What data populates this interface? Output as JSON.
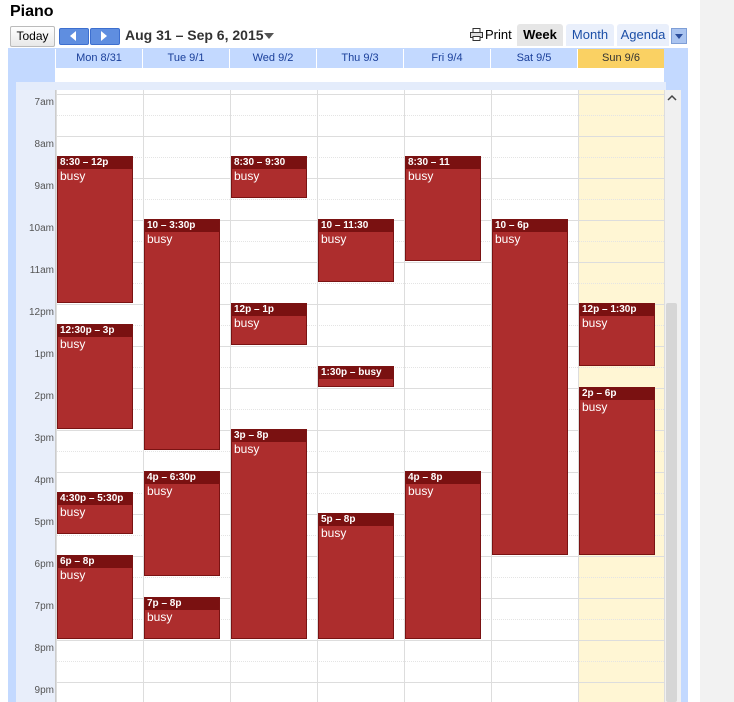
{
  "calendar": {
    "title": "Piano",
    "today_label": "Today",
    "date_range": "Aug 31 – Sep 6, 2015",
    "print_label": "Print",
    "tabs": {
      "week": "Week",
      "month": "Month",
      "agenda": "Agenda"
    }
  },
  "days": [
    "Mon 8/31",
    "Tue 9/1",
    "Wed 9/2",
    "Thu 9/3",
    "Fri 9/4",
    "Sat 9/5",
    "Sun 9/6"
  ],
  "highlighted_day": "Sun 9/6",
  "hours": [
    "7am",
    "8am",
    "9am",
    "10am",
    "11am",
    "12pm",
    "1pm",
    "2pm",
    "3pm",
    "4pm",
    "5pm",
    "6pm",
    "7pm",
    "8pm",
    "9pm"
  ],
  "events": [
    {
      "day": 0,
      "start": 8.5,
      "end": 12,
      "time": "8:30 – 12p",
      "label": "busy"
    },
    {
      "day": 0,
      "start": 12.5,
      "end": 15,
      "time": "12:30p – 3p",
      "label": "busy"
    },
    {
      "day": 0,
      "start": 16.5,
      "end": 17.5,
      "time": "4:30p – 5:30p",
      "label": "busy"
    },
    {
      "day": 0,
      "start": 18,
      "end": 20,
      "time": "6p – 8p",
      "label": "busy"
    },
    {
      "day": 1,
      "start": 10,
      "end": 15.5,
      "time": "10 – 3:30p",
      "label": "busy"
    },
    {
      "day": 1,
      "start": 16,
      "end": 18.5,
      "time": "4p – 6:30p",
      "label": "busy"
    },
    {
      "day": 1,
      "start": 19,
      "end": 20,
      "time": "7p – 8p",
      "label": "busy"
    },
    {
      "day": 2,
      "start": 8.5,
      "end": 9.5,
      "time": "8:30 – 9:30",
      "label": "busy"
    },
    {
      "day": 2,
      "start": 12,
      "end": 13,
      "time": "12p – 1p",
      "label": "busy"
    },
    {
      "day": 2,
      "start": 15,
      "end": 20,
      "time": "3p – 8p",
      "label": "busy"
    },
    {
      "day": 3,
      "start": 10,
      "end": 11.5,
      "time": "10 – 11:30",
      "label": "busy"
    },
    {
      "day": 3,
      "start": 13.5,
      "end": 14,
      "time": "1:30p – busy",
      "label": ""
    },
    {
      "day": 3,
      "start": 17,
      "end": 20,
      "time": "5p – 8p",
      "label": "busy"
    },
    {
      "day": 4,
      "start": 8.5,
      "end": 11,
      "time": "8:30 – 11",
      "label": "busy"
    },
    {
      "day": 4,
      "start": 16,
      "end": 20,
      "time": "4p – 8p",
      "label": "busy"
    },
    {
      "day": 5,
      "start": 10,
      "end": 18,
      "time": "10 – 6p",
      "label": "busy"
    },
    {
      "day": 6,
      "start": 12,
      "end": 13.5,
      "time": "12p – 1:30p",
      "label": "busy"
    },
    {
      "day": 6,
      "start": 14,
      "end": 18,
      "time": "2p – 6p",
      "label": "busy"
    }
  ]
}
